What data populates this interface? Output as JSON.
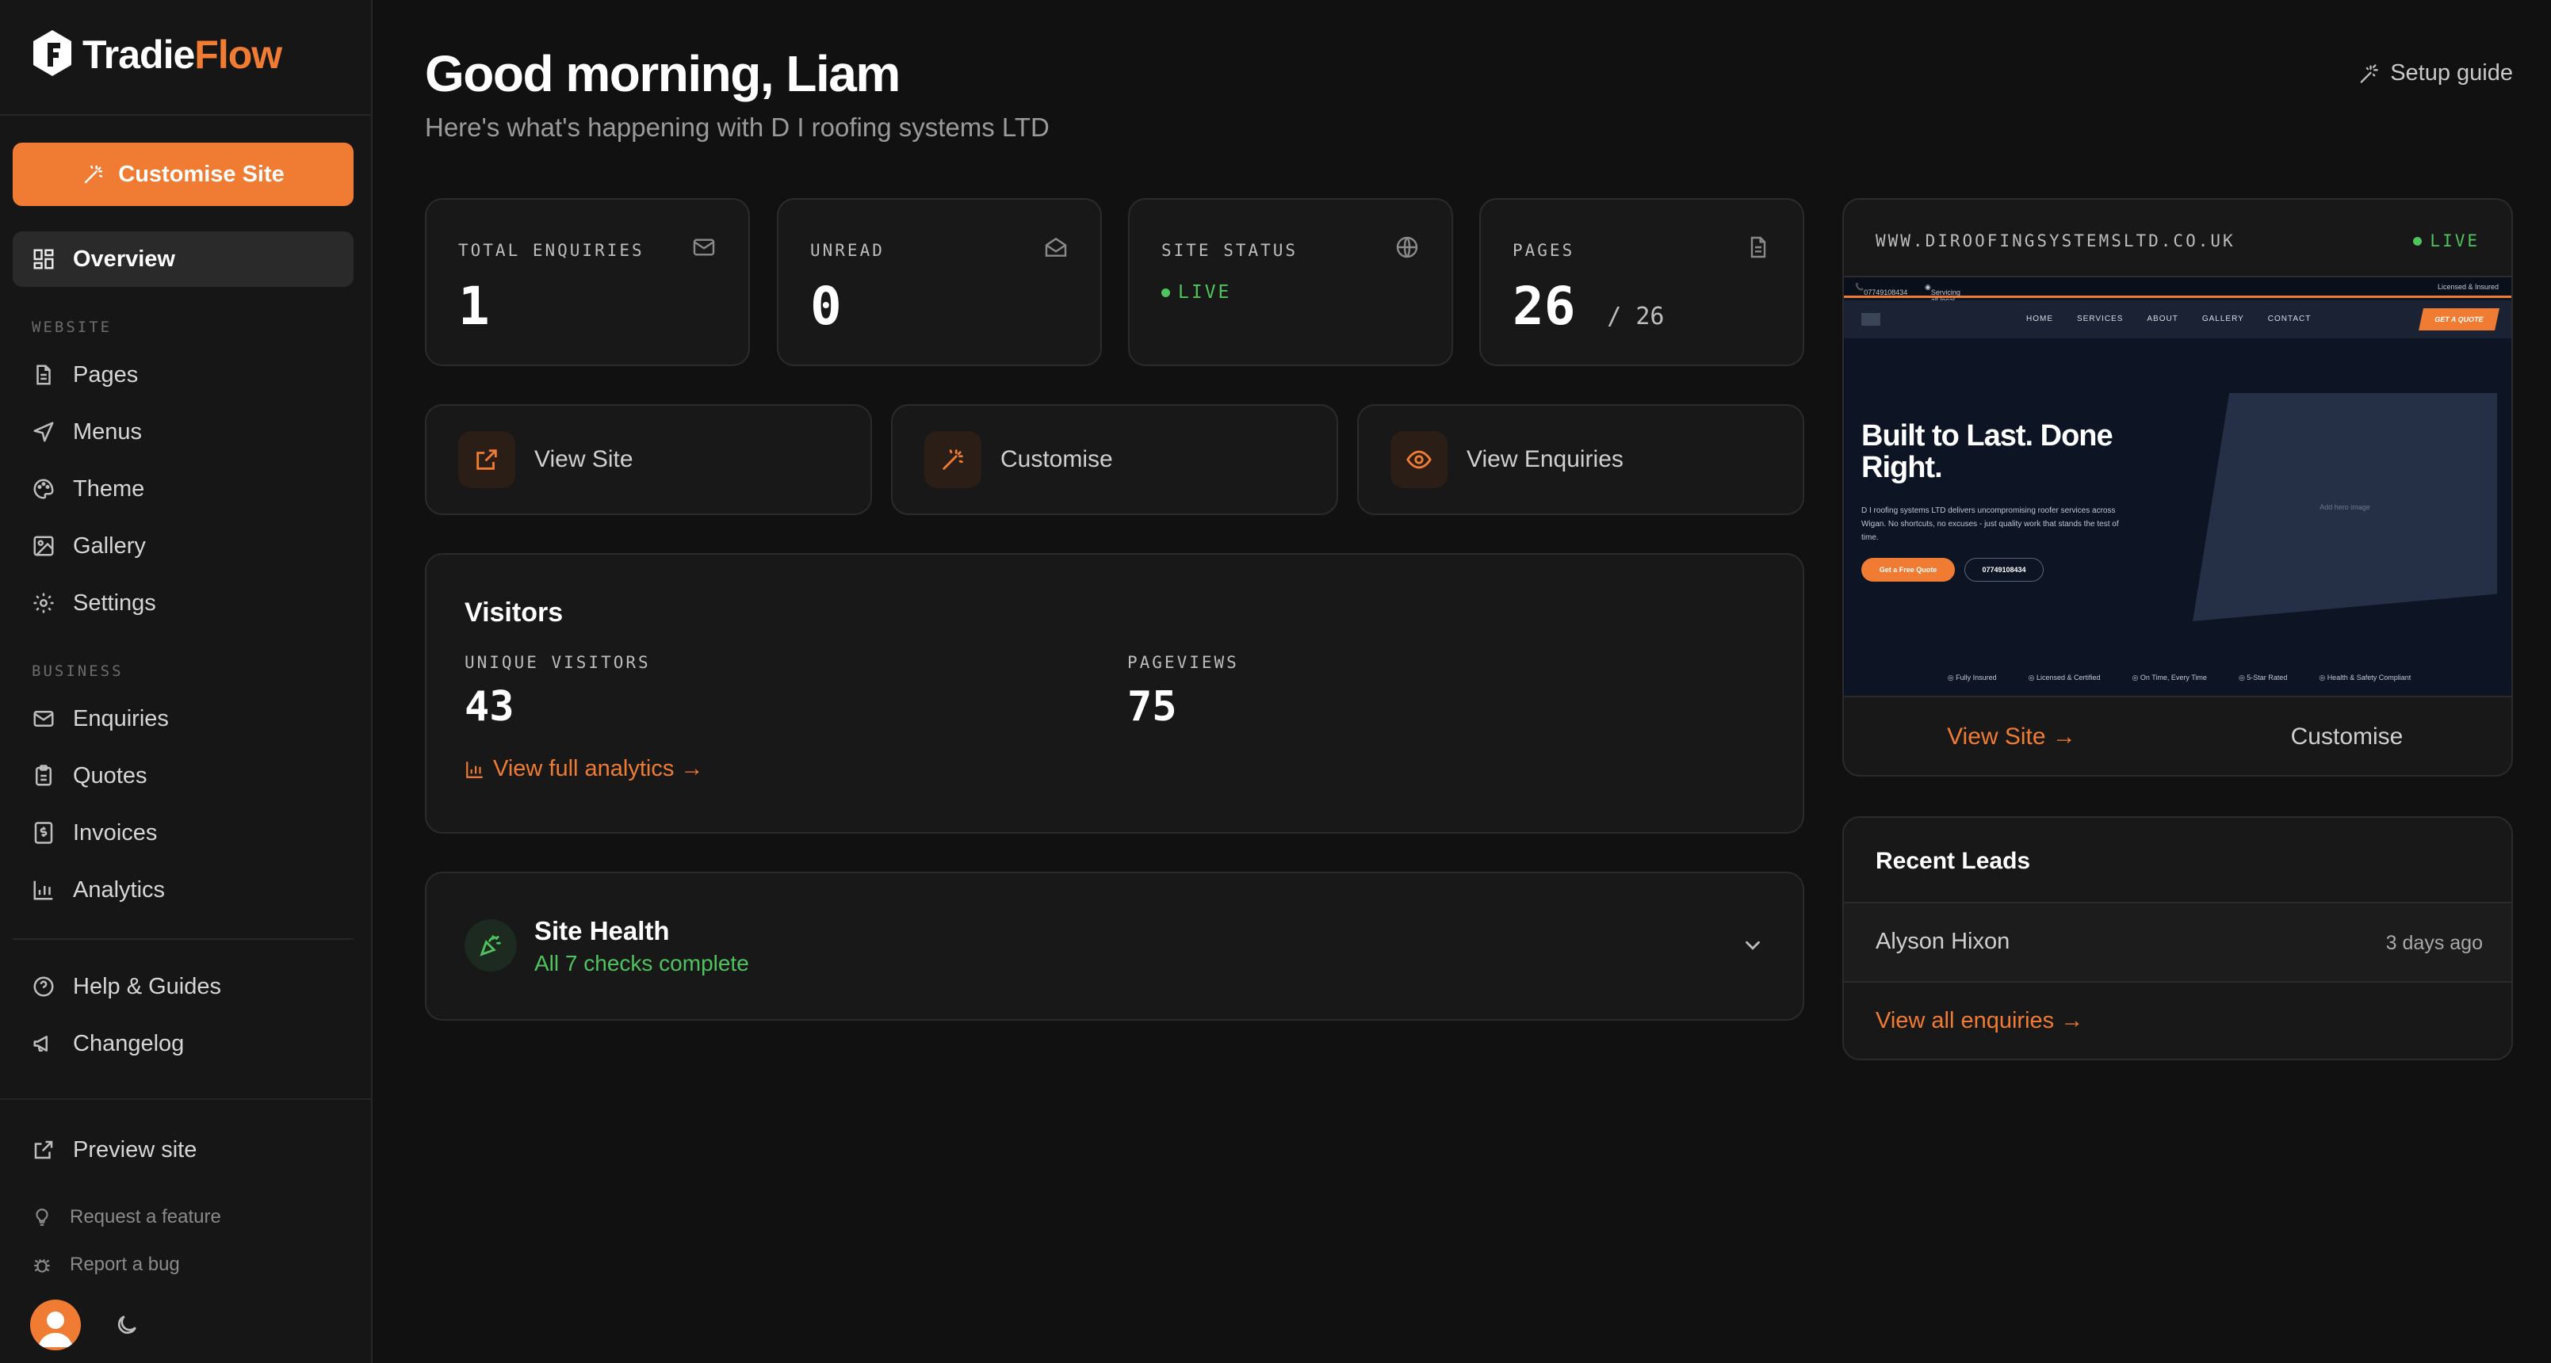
{
  "brand": {
    "name_part1": "Tradie",
    "name_part2": "Flow"
  },
  "sidebar": {
    "customise_button": "Customise Site",
    "overview": "Overview",
    "website_label": "WEBSITE",
    "website_items": [
      "Pages",
      "Menus",
      "Theme",
      "Gallery",
      "Settings"
    ],
    "business_label": "BUSINESS",
    "business_items": [
      "Enquiries",
      "Quotes",
      "Invoices",
      "Analytics"
    ],
    "help": "Help & Guides",
    "changelog": "Changelog",
    "preview": "Preview site",
    "request_feature": "Request a feature",
    "report_bug": "Report a bug"
  },
  "header": {
    "greeting": "Good morning, Liam",
    "subtitle": "Here's what's happening with D I roofing systems LTD",
    "setup_guide": "Setup guide"
  },
  "stats": {
    "total_enquiries": {
      "label": "TOTAL ENQUIRIES",
      "value": "1"
    },
    "unread": {
      "label": "UNREAD",
      "value": "0"
    },
    "site_status": {
      "label": "SITE STATUS",
      "value": "LIVE"
    },
    "pages": {
      "label": "PAGES",
      "value": "26",
      "of": "/ 26"
    }
  },
  "actions": {
    "view_site": "View Site",
    "customise": "Customise",
    "view_enquiries": "View Enquiries"
  },
  "visitors": {
    "title": "Visitors",
    "unique_label": "UNIQUE VISITORS",
    "unique_value": "43",
    "pageviews_label": "PAGEVIEWS",
    "pageviews_value": "75",
    "analytics_link": "View full analytics →"
  },
  "health": {
    "title": "Site Health",
    "subtitle": "All 7 checks complete"
  },
  "preview": {
    "url": "WWW.DIROOFINGSYSTEMSLTD.CO.UK",
    "status": "LIVE",
    "site": {
      "phone": "07749108434",
      "servicing": "Servicing all local areas",
      "insured": "Licensed & Insured",
      "nav": [
        "HOME",
        "SERVICES",
        "ABOUT",
        "GALLERY",
        "CONTACT"
      ],
      "quote_button": "GET A QUOTE",
      "hero_title": "Built to Last. Done Right.",
      "hero_text": "D I roofing systems LTD delivers uncompromising roofer services across Wigan. No shortcuts, no excuses - just quality work that stands the test of time.",
      "cta_primary": "Get a Free Quote",
      "cta_secondary": "07749108434",
      "image_placeholder": "Add hero image",
      "trust": [
        "Fully Insured",
        "Licensed & Certified",
        "On Time, Every Time",
        "5-Star Rated",
        "Health & Safety Compliant"
      ]
    },
    "view_site": "View Site →",
    "customise": "Customise"
  },
  "leads": {
    "title": "Recent Leads",
    "items": [
      {
        "name": "Alyson Hixon",
        "time": "3 days ago"
      }
    ],
    "view_all": "View all enquiries →"
  },
  "colors": {
    "accent": "#f07c33",
    "live": "#4fc35d",
    "background": "#111111",
    "card": "#181818"
  }
}
